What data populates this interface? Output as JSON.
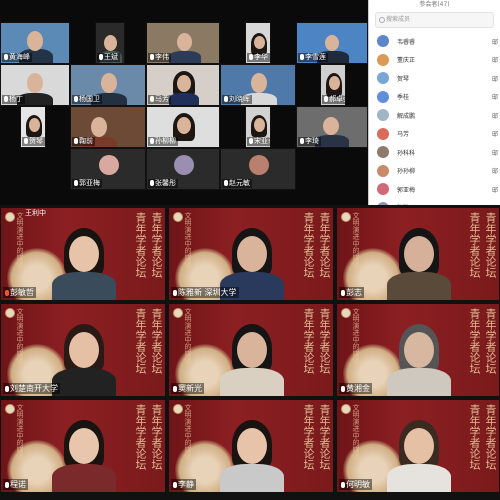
{
  "panel": {
    "title": "参会者(47)",
    "search_placeholder": "搜索成员",
    "participants": [
      {
        "name": "韦睿睿",
        "right": "邸",
        "color": "#5b86c9"
      },
      {
        "name": "董庆正",
        "right": "邸",
        "color": "#d99b56"
      },
      {
        "name": "贺琴",
        "right": "邸",
        "color": "#7aa6d6"
      },
      {
        "name": "季桂",
        "right": "邸",
        "color": "#5f8fd8"
      },
      {
        "name": "解成鹏",
        "right": "邸",
        "color": "#a0b6c8"
      },
      {
        "name": "马芳",
        "right": "邸",
        "color": "#d96b5a"
      },
      {
        "name": "孙科科",
        "right": "邸",
        "color": "#8e7a6a"
      },
      {
        "name": "孙孙柳",
        "right": "邸",
        "color": "#c98a6a"
      },
      {
        "name": "郭亚梅",
        "right": "邸",
        "color": "#d06a78"
      },
      {
        "name": "张馨彤",
        "right": "邸",
        "color": "#9a8fb0"
      },
      {
        "name": "赵元敏",
        "right": "邸",
        "color": "#b98070"
      }
    ]
  },
  "top_tiles": [
    {
      "name": "黄海峰",
      "bg": "#5a8ab5"
    },
    {
      "name": "王斌",
      "bg": "#2a2a2a"
    },
    {
      "name": "李伟",
      "bg": "#8a7a63"
    },
    {
      "name": "李华",
      "bg": "#d8d8d8"
    },
    {
      "name": "李雪莲",
      "bg": "#4d85c4"
    },
    {
      "name": "杨丁",
      "bg": "#d9d9d9"
    },
    {
      "name": "杨国卫",
      "bg": "#6b89a8"
    },
    {
      "name": "马芳",
      "bg": "#d5cfc8"
    },
    {
      "name": "刘晓晖",
      "bg": "#4f79a8"
    },
    {
      "name": "郝卓强",
      "bg": "#cfcfcf"
    },
    {
      "name": "贺琴",
      "bg": "#e5e5e5"
    },
    {
      "name": "鞠前",
      "bg": "#6d4a35"
    },
    {
      "name": "孙柳柳",
      "bg": "#dedede"
    },
    {
      "name": "宋亚莉",
      "bg": "#d2d2d2"
    },
    {
      "name": "李琦",
      "bg": "#6d6d6d"
    },
    {
      "name": "郭亚梅",
      "bg": "#2b2b2b"
    },
    {
      "name": "张馨彤",
      "bg": "#2b2b2b"
    },
    {
      "name": "赵元敏",
      "bg": "#2b2b2b"
    }
  ],
  "bottom_tiles": [
    {
      "name": "彭敏哲",
      "muted": true
    },
    {
      "name": "陈雅新 深圳大学",
      "muted": false
    },
    {
      "name": "彭志",
      "muted": false
    },
    {
      "name": "刘楚南开大学",
      "muted": false
    },
    {
      "name": "窦新光",
      "muted": false
    },
    {
      "name": "黄湘金",
      "muted": false
    },
    {
      "name": "程诺",
      "muted": false
    },
    {
      "name": "李静",
      "muted": false
    },
    {
      "name": "何明敏",
      "muted": false
    }
  ],
  "banner": {
    "vertical_main": "青年学者论坛",
    "vertical_small": "文明演进中的媒体"
  },
  "header_label": "王利中"
}
